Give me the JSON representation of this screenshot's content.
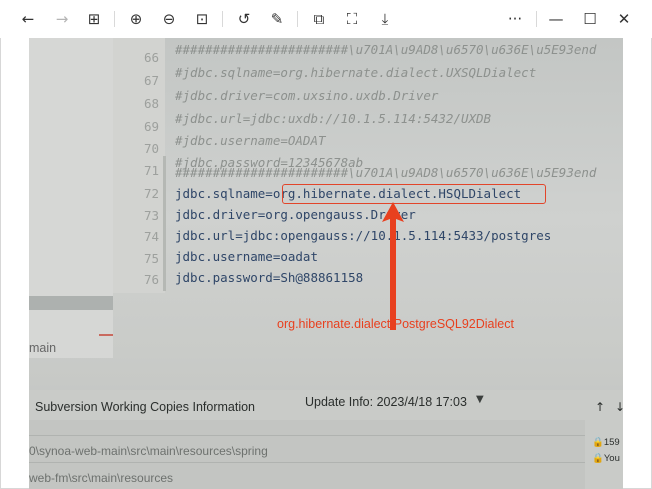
{
  "viewer": {
    "toolbar": {
      "back_icon": "←",
      "forward_icon": "→",
      "grid_icon": "⊞",
      "zoom_in_icon": "⊕",
      "zoom_out_icon": "⊖",
      "fit_icon": "⊡",
      "rotate_icon": "↺",
      "edit_icon": "✎",
      "copy_icon": "⧉",
      "crop_icon": "⛶",
      "save_icon": "⤓",
      "more_icon": "···",
      "minimize_icon": "—",
      "maximize_icon": "☐",
      "close_icon": "✕"
    }
  },
  "photo": {
    "line_numbers": [
      "66",
      "67",
      "68",
      "69",
      "70",
      "71",
      "72",
      "73",
      "74",
      "75",
      "76"
    ],
    "code_lines": [
      "#######################\\u701A\\u9AD8\\u6570\\u636E\\u5E93end",
      "#jdbc.sqlname=org.hibernate.dialect.UXSQLDialect",
      "#jdbc.driver=com.uxsino.uxdb.Driver",
      "#jdbc.url=jdbc:uxdb://10.1.5.114:5432/UXDB",
      "#jdbc.username=OADAT",
      "#jdbc.password=12345678ab",
      "#######################\\u701A\\u9AD8\\u6570\\u636E\\u5E93end",
      "jdbc.sqlname=org.hibernate.dialect.HSQLDialect",
      "jdbc.driver=org.opengauss.Driver",
      "jdbc.url=jdbc:opengauss://10.1.5.114:5433/postgres",
      "jdbc.username=oadat",
      "jdbc.password=Sh@88861158"
    ],
    "annotation": "org.hibernate.dialect.PostgreSQL92Dialect",
    "annotation_color": "#e8401f",
    "left_label": "main",
    "panel": {
      "title": "Subversion Working Copies Information",
      "update_info": "Update Info: 2023/4/18 17:03",
      "paths": [
        "0\\synoa-web-main\\src\\main\\resources\\spring",
        "web-fm\\src\\main\\resources"
      ],
      "side_count": "159",
      "side_label": "You"
    }
  }
}
